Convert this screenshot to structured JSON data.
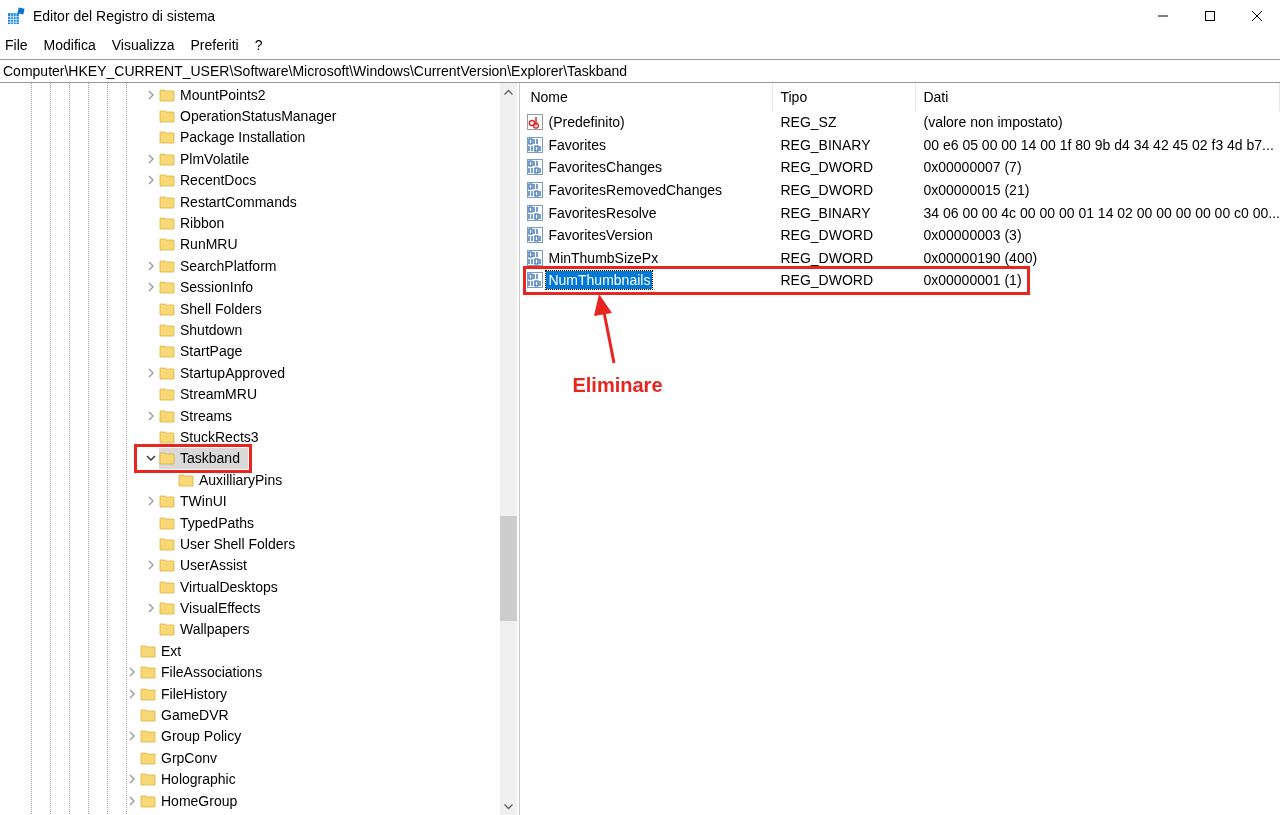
{
  "window": {
    "title": "Editor del Registro di sistema"
  },
  "menu": [
    {
      "label": "File"
    },
    {
      "label": "Modifica"
    },
    {
      "label": "Visualizza"
    },
    {
      "label": "Preferiti"
    },
    {
      "label": "?"
    }
  ],
  "address": "Computer\\HKEY_CURRENT_USER\\Software\\Microsoft\\Windows\\CurrentVersion\\Explorer\\Taskband",
  "tree": [
    {
      "children": [
        {
          "label": "MountPoints2",
          "expanded": false,
          "selected": false,
          "highlighted": false
        },
        {
          "label": "OperationStatusManager",
          "selected": false,
          "highlighted": false
        },
        {
          "label": "Package Installation",
          "selected": false,
          "highlighted": false
        },
        {
          "label": "PlmVolatile",
          "expanded": false,
          "selected": false,
          "highlighted": false
        },
        {
          "label": "RecentDocs",
          "expanded": false,
          "selected": false,
          "highlighted": false
        },
        {
          "label": "RestartCommands",
          "selected": false,
          "highlighted": false
        },
        {
          "label": "Ribbon",
          "selected": false,
          "highlighted": false
        },
        {
          "label": "RunMRU",
          "selected": false,
          "highlighted": false
        },
        {
          "label": "SearchPlatform",
          "expanded": false,
          "selected": false,
          "highlighted": false
        },
        {
          "label": "SessionInfo",
          "expanded": false,
          "selected": false,
          "highlighted": false
        },
        {
          "label": "Shell Folders",
          "selected": false,
          "highlighted": false
        },
        {
          "label": "Shutdown",
          "selected": false,
          "highlighted": false
        },
        {
          "label": "StartPage",
          "selected": false,
          "highlighted": false
        },
        {
          "label": "StartupApproved",
          "expanded": false,
          "selected": false,
          "highlighted": false
        },
        {
          "label": "StreamMRU",
          "selected": false,
          "highlighted": false
        },
        {
          "label": "Streams",
          "expanded": false,
          "selected": false,
          "highlighted": false
        },
        {
          "label": "StuckRects3",
          "selected": false,
          "highlighted": false
        },
        {
          "label": "Taskband",
          "expanded": true,
          "selected": true,
          "highlighted": true,
          "children": [
            {
              "label": "AuxilliaryPins",
              "selected": false,
              "highlighted": false
            }
          ]
        },
        {
          "label": "TWinUI",
          "expanded": false,
          "selected": false,
          "highlighted": false
        },
        {
          "label": "TypedPaths",
          "selected": false,
          "highlighted": false
        },
        {
          "label": "User Shell Folders",
          "selected": false,
          "highlighted": false
        },
        {
          "label": "UserAssist",
          "expanded": false,
          "selected": false,
          "highlighted": false
        },
        {
          "label": "VirtualDesktops",
          "selected": false,
          "highlighted": false
        },
        {
          "label": "VisualEffects",
          "expanded": false,
          "selected": false,
          "highlighted": false
        },
        {
          "label": "Wallpapers",
          "selected": false,
          "highlighted": false
        }
      ]
    },
    {
      "label": "Ext",
      "selected": false,
      "highlighted": false
    },
    {
      "label": "FileAssociations",
      "expanded": false,
      "selected": false,
      "highlighted": false
    },
    {
      "label": "FileHistory",
      "expanded": false,
      "selected": false,
      "highlighted": false
    },
    {
      "label": "GameDVR",
      "selected": false,
      "highlighted": false
    },
    {
      "label": "Group Policy",
      "expanded": false,
      "selected": false,
      "highlighted": false
    },
    {
      "label": "GrpConv",
      "selected": false,
      "highlighted": false
    },
    {
      "label": "Holographic",
      "expanded": false,
      "selected": false,
      "highlighted": false
    },
    {
      "label": "HomeGroup",
      "expanded": false,
      "selected": false,
      "highlighted": false
    }
  ],
  "values": {
    "columns": [
      "Nome",
      "Tipo",
      "Dati"
    ],
    "rows": [
      {
        "kind": "string",
        "name": "(Predefinito)",
        "type": "REG_SZ",
        "data": "(valore non impostato)",
        "selected": false,
        "highlighted": false
      },
      {
        "kind": "binary",
        "name": "Favorites",
        "type": "REG_BINARY",
        "data": "00 e6 05 00 00 14 00 1f 80 9b d4 34 42 45 02 f3 4d b7...",
        "selected": false,
        "highlighted": false
      },
      {
        "kind": "binary",
        "name": "FavoritesChanges",
        "type": "REG_DWORD",
        "data": "0x00000007 (7)",
        "selected": false,
        "highlighted": false
      },
      {
        "kind": "binary",
        "name": "FavoritesRemovedChanges",
        "type": "REG_DWORD",
        "data": "0x00000015 (21)",
        "selected": false,
        "highlighted": false
      },
      {
        "kind": "binary",
        "name": "FavoritesResolve",
        "type": "REG_BINARY",
        "data": "34 06 00 00 4c 00 00 00 01 14 02 00 00 00 00 00 c0 00...",
        "selected": false,
        "highlighted": false
      },
      {
        "kind": "binary",
        "name": "FavoritesVersion",
        "type": "REG_DWORD",
        "data": "0x00000003 (3)",
        "selected": false,
        "highlighted": false
      },
      {
        "kind": "binary",
        "name": "MinThumbSizePx",
        "type": "REG_DWORD",
        "data": "0x00000190 (400)",
        "selected": false,
        "highlighted": false
      },
      {
        "kind": "binary",
        "name": "NumThumbnails",
        "type": "REG_DWORD",
        "data": "0x00000001 (1)",
        "selected": true,
        "highlighted": true
      }
    ]
  },
  "annotation": {
    "text": "Eliminare"
  }
}
